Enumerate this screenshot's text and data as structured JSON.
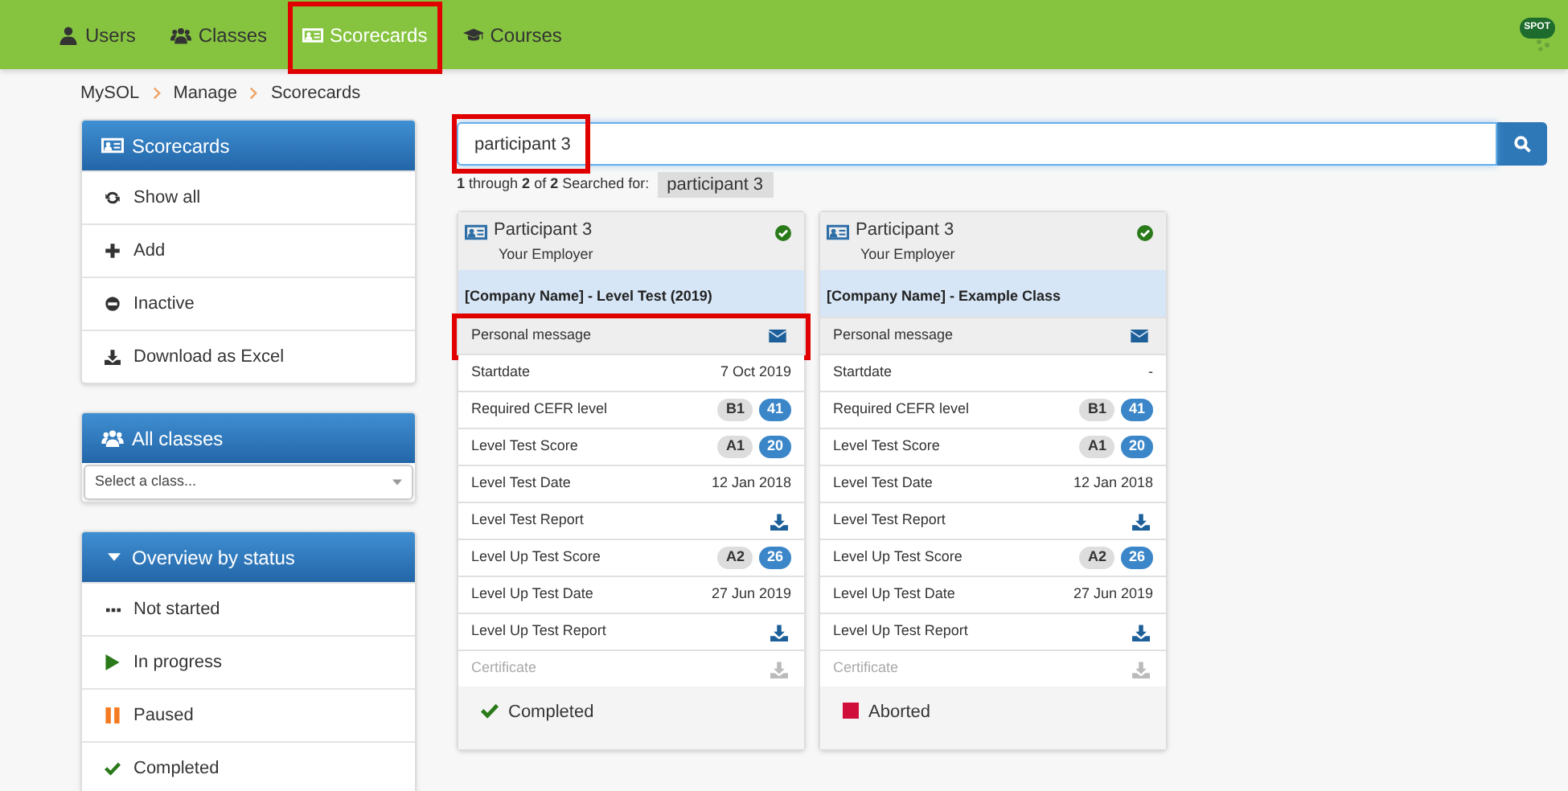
{
  "nav": {
    "items": [
      {
        "label": "Users",
        "selected": false,
        "highlighted": false
      },
      {
        "label": "Classes",
        "selected": false,
        "highlighted": false
      },
      {
        "label": "Scorecards",
        "selected": true,
        "highlighted": true
      },
      {
        "label": "Courses",
        "selected": false,
        "highlighted": false
      }
    ],
    "logo_text": "SPOT"
  },
  "breadcrumb": [
    "MySOL",
    "Manage",
    "Scorecards"
  ],
  "sidebar": {
    "panels": [
      {
        "title": "Scorecards",
        "items": [
          {
            "label": "Show all"
          },
          {
            "label": "Add"
          },
          {
            "label": "Inactive"
          },
          {
            "label": "Download as Excel"
          }
        ]
      },
      {
        "title": "All classes",
        "select": {
          "placeholder": "Select a class..."
        }
      },
      {
        "title": "Overview by status",
        "items": [
          {
            "label": "Not started"
          },
          {
            "label": "In progress"
          },
          {
            "label": "Paused"
          },
          {
            "label": "Completed"
          }
        ]
      }
    ]
  },
  "search": {
    "value": "participant 3",
    "highlighted": true,
    "summary": "**1** through **2** of **2** Searched for:",
    "tag": "participant 3"
  },
  "cards": [
    {
      "name": "Participant 3",
      "employer": "Your Employer",
      "verified": true,
      "class": "[Company Name] - Level Test (2019)",
      "rows": [
        {
          "kind": "message",
          "label": "Personal message",
          "highlighted": true
        },
        {
          "kind": "text",
          "label": "Startdate",
          "value": "7 Oct 2019"
        },
        {
          "kind": "badges",
          "label": "Required CEFR level",
          "level": "B1",
          "score": "41"
        },
        {
          "kind": "badges",
          "label": "Level Test Score",
          "level": "A1",
          "score": "20"
        },
        {
          "kind": "text",
          "label": "Level Test Date",
          "value": "12 Jan 2018"
        },
        {
          "kind": "download",
          "label": "Level Test Report",
          "disabled": false
        },
        {
          "kind": "badges",
          "label": "Level Up Test Score",
          "level": "A2",
          "score": "26"
        },
        {
          "kind": "text",
          "label": "Level Up Test Date",
          "value": "27 Jun 2019"
        },
        {
          "kind": "download",
          "label": "Level Up Test Report",
          "disabled": false
        },
        {
          "kind": "download",
          "label": "Certificate",
          "disabled": true
        }
      ],
      "status": {
        "kind": "completed",
        "label": "Completed"
      }
    },
    {
      "name": "Participant 3",
      "employer": "Your Employer",
      "verified": true,
      "class": "[Company Name] - Example Class",
      "rows": [
        {
          "kind": "message",
          "label": "Personal message",
          "highlighted": false
        },
        {
          "kind": "text",
          "label": "Startdate",
          "value": "-"
        },
        {
          "kind": "badges",
          "label": "Required CEFR level",
          "level": "B1",
          "score": "41"
        },
        {
          "kind": "badges",
          "label": "Level Test Score",
          "level": "A1",
          "score": "20"
        },
        {
          "kind": "text",
          "label": "Level Test Date",
          "value": "12 Jan 2018"
        },
        {
          "kind": "download",
          "label": "Level Test Report",
          "disabled": false
        },
        {
          "kind": "badges",
          "label": "Level Up Test Score",
          "level": "A2",
          "score": "26"
        },
        {
          "kind": "text",
          "label": "Level Up Test Date",
          "value": "27 Jun 2019"
        },
        {
          "kind": "download",
          "label": "Level Up Test Report",
          "disabled": false
        },
        {
          "kind": "download",
          "label": "Certificate",
          "disabled": true
        }
      ],
      "status": {
        "kind": "aborted",
        "label": "Aborted"
      }
    }
  ]
}
